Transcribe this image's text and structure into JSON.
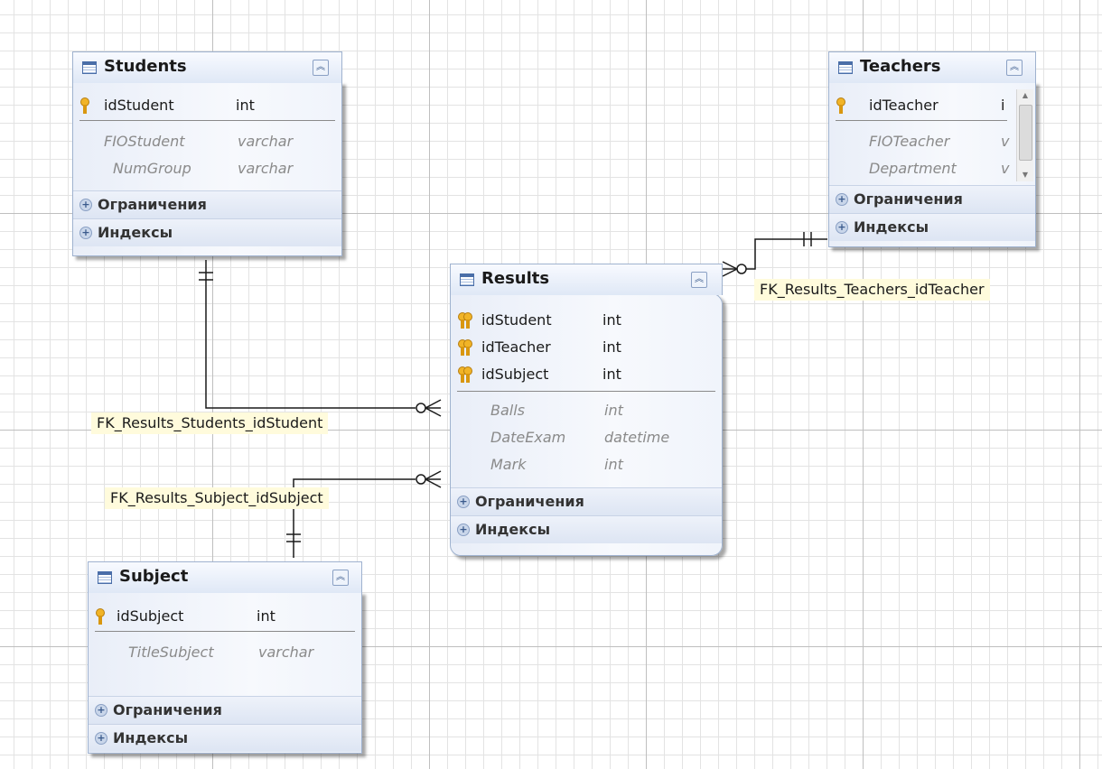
{
  "diagram": {
    "section_constraints": "Ограничения",
    "section_indexes": "Индексы",
    "tables": {
      "students": {
        "title": "Students",
        "key_fields": [
          {
            "name": "idStudent",
            "type": "int"
          }
        ],
        "fields": [
          {
            "name": "FIOStudent",
            "type": "varchar"
          },
          {
            "name": "NumGroup",
            "type": "varchar"
          }
        ]
      },
      "teachers": {
        "title": "Teachers",
        "key_fields": [
          {
            "name": "idTeacher",
            "type": "i"
          }
        ],
        "fields": [
          {
            "name": "FIOTeacher",
            "type": "v"
          },
          {
            "name": "Department",
            "type": "v"
          }
        ]
      },
      "results": {
        "title": "Results",
        "key_fields": [
          {
            "name": "idStudent",
            "type": "int"
          },
          {
            "name": "idTeacher",
            "type": "int"
          },
          {
            "name": "idSubject",
            "type": "int"
          }
        ],
        "fields": [
          {
            "name": "Balls",
            "type": "int"
          },
          {
            "name": "DateExam",
            "type": "datetime"
          },
          {
            "name": "Mark",
            "type": "int"
          }
        ]
      },
      "subject": {
        "title": "Subject",
        "key_fields": [
          {
            "name": "idSubject",
            "type": "int"
          }
        ],
        "fields": [
          {
            "name": "TitleSubject",
            "type": "varchar"
          }
        ]
      }
    },
    "relationships": [
      {
        "name": "FK_Results_Students_idStudent",
        "from": "Results",
        "to": "Students"
      },
      {
        "name": "FK_Results_Subject_idSubject",
        "from": "Results",
        "to": "Subject"
      },
      {
        "name": "FK_Results_Teachers_idTeacher",
        "from": "Results",
        "to": "Teachers"
      }
    ]
  }
}
